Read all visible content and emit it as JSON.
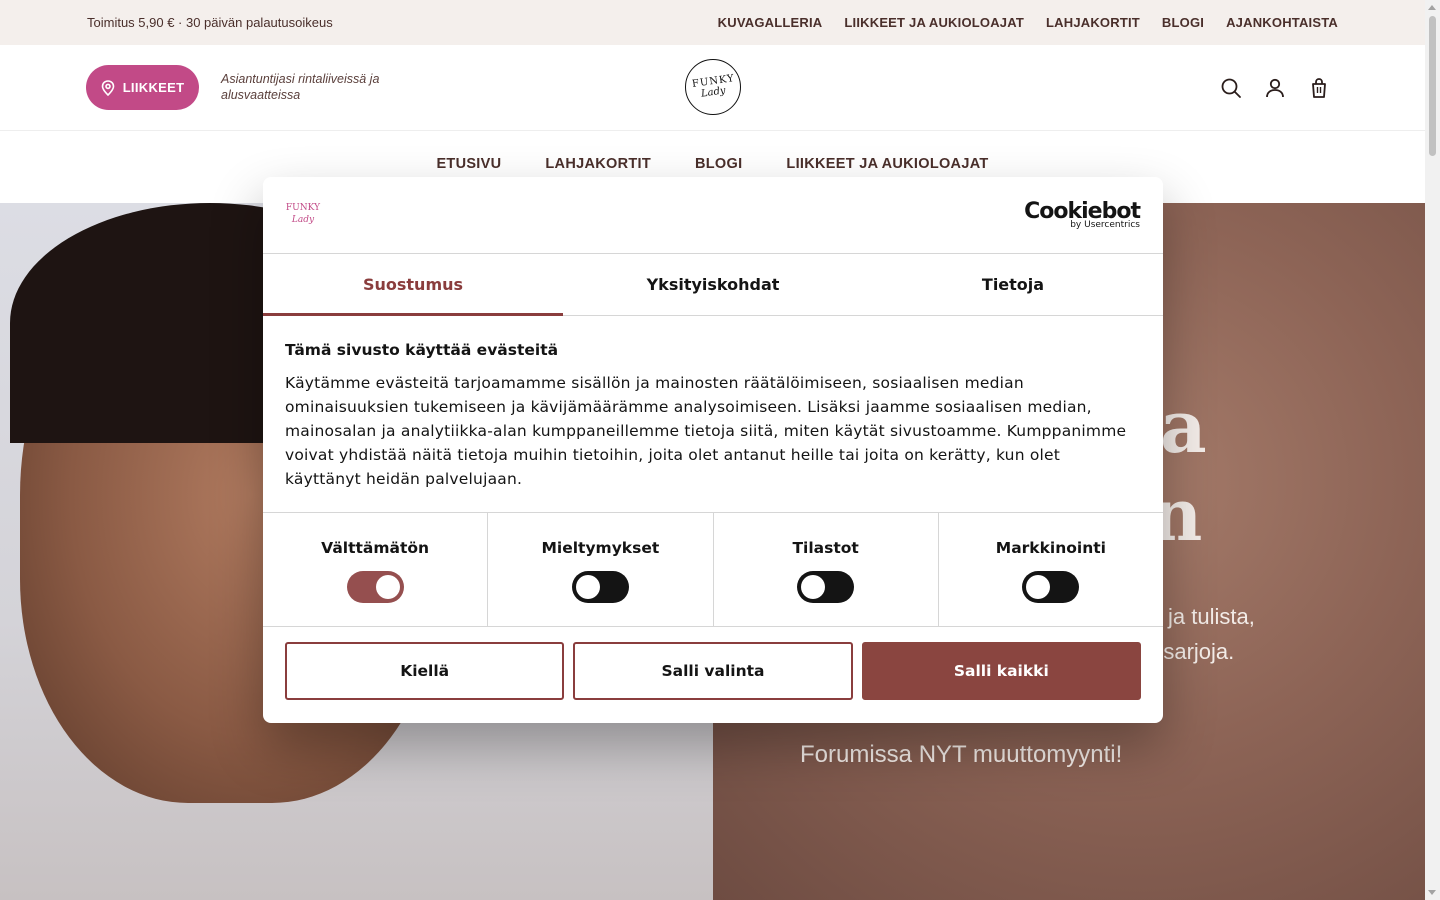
{
  "topbar": {
    "announcement": "Toimitus 5,90 € · 30 päivän palautusoikeus",
    "links": [
      "KUVAGALLERIA",
      "LIIKKEET JA AUKIOLOAJAT",
      "LAHJAKORTIT",
      "BLOGI",
      "AJANKOHTAISTA"
    ]
  },
  "header": {
    "stores_label": "LIIKKEET",
    "tagline": "Asiantuntijasi rintaliiveissä ja alusvaatteissa",
    "logo_top": "FUNKY",
    "logo_bottom": "Lady",
    "icons": [
      "search-icon",
      "account-icon",
      "cart-icon"
    ]
  },
  "mainnav": {
    "items": [
      "ETUSIVU",
      "LAHJAKORTIT",
      "BLOGI",
      "LIIKKEET JA AUKIOLOAJAT"
    ]
  },
  "hero": {
    "big_line_1": "a",
    "big_line_2": "n",
    "sub_line_1": "ja tulista,",
    "sub_line_2": "n sarjoja.",
    "cta": "Forumissa NYT muuttomyynti!"
  },
  "cookie": {
    "logo_top": "FUNKY",
    "logo_bottom": "Lady",
    "brand": "Cookiebot",
    "brand_sub": "by Usercentrics",
    "tabs": [
      "Suostumus",
      "Yksityiskohdat",
      "Tietoja"
    ],
    "title": "Tämä sivusto käyttää evästeitä",
    "text": "Käytämme evästeitä tarjoamamme sisällön ja mainosten räätälöimiseen, sosiaalisen median ominaisuuksien tukemiseen ja kävijämäärämme analysoimiseen. Lisäksi jaamme sosiaalisen median, mainosalan ja analytiikka-alan kumppaneillemme tietoja siitä, miten käytät sivustoamme. Kumppanimme voivat yhdistää näitä tietoja muihin tietoihin, joita olet antanut heille tai joita on kerätty, kun olet käyttänyt heidän palvelujaan.",
    "toggles": [
      {
        "label": "Välttämätön",
        "on": true
      },
      {
        "label": "Mieltymykset",
        "on": false
      },
      {
        "label": "Tilastot",
        "on": false
      },
      {
        "label": "Markkinointi",
        "on": false
      }
    ],
    "buttons": {
      "deny": "Kiellä",
      "allow_selection": "Salli valinta",
      "allow_all": "Salli kaikki"
    },
    "accent_color": "#8a3d3d"
  }
}
